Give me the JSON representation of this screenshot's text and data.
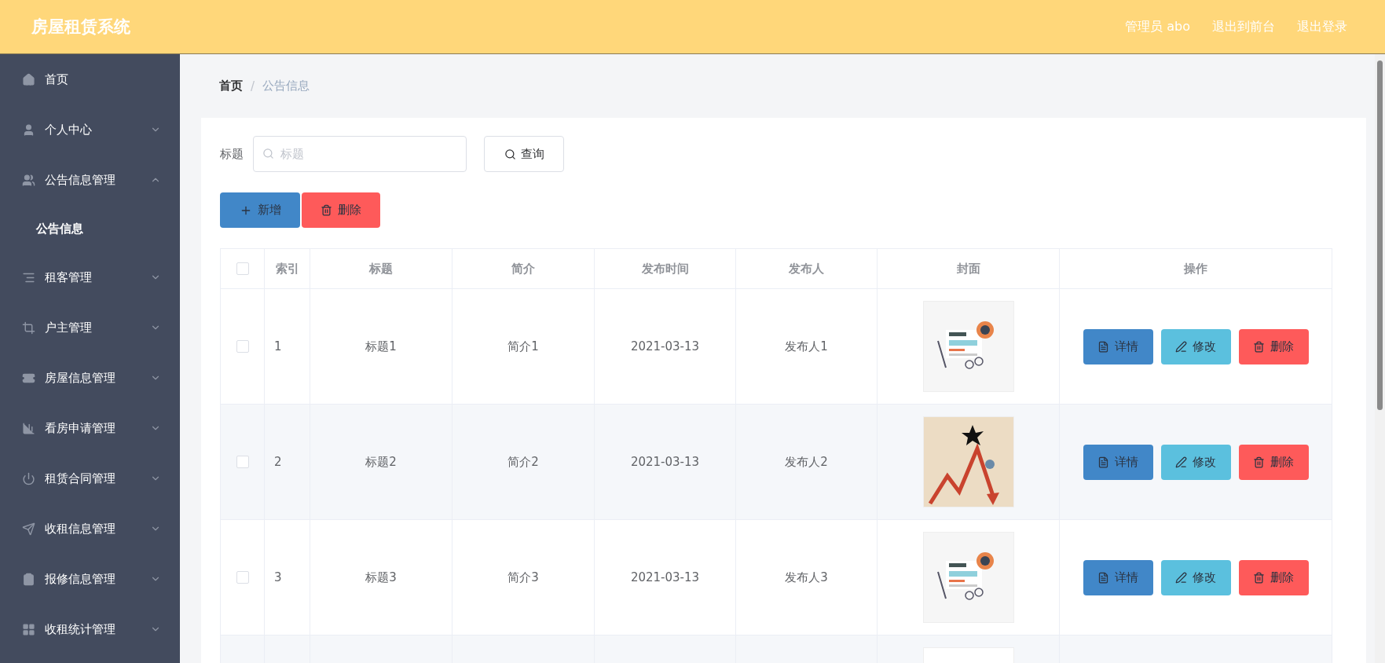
{
  "header": {
    "title": "房屋租赁系统",
    "links": [
      "管理员 abo",
      "退出到前台",
      "退出登录"
    ]
  },
  "sidebar": {
    "items": [
      {
        "label": "首页",
        "kind": "link"
      },
      {
        "label": "个人中心",
        "kind": "submenu",
        "expanded": false
      },
      {
        "label": "公告信息管理",
        "kind": "submenu",
        "expanded": true,
        "children": [
          {
            "label": "公告信息",
            "selected": true
          }
        ]
      },
      {
        "label": "租客管理",
        "kind": "submenu",
        "expanded": false
      },
      {
        "label": "户主管理",
        "kind": "submenu",
        "expanded": false
      },
      {
        "label": "房屋信息管理",
        "kind": "submenu",
        "expanded": false
      },
      {
        "label": "看房申请管理",
        "kind": "submenu",
        "expanded": false
      },
      {
        "label": "租赁合同管理",
        "kind": "submenu",
        "expanded": false
      },
      {
        "label": "收租信息管理",
        "kind": "submenu",
        "expanded": false
      },
      {
        "label": "报修信息管理",
        "kind": "submenu",
        "expanded": false
      },
      {
        "label": "收租统计管理",
        "kind": "submenu",
        "expanded": false
      }
    ]
  },
  "breadcrumb": {
    "items": [
      "首页",
      "公告信息"
    ],
    "separator": "/"
  },
  "search": {
    "label": "标题",
    "placeholder": "标题",
    "button": "查询"
  },
  "actions": {
    "add": "新增",
    "delete": "删除"
  },
  "table": {
    "header_checked": false,
    "columns": [
      "索引",
      "标题",
      "简介",
      "发布时间",
      "发布人",
      "封面",
      "操作"
    ],
    "rows": [
      {
        "checked": false,
        "index": "1",
        "title": "标题1",
        "summary": "简介1",
        "date": "2021-03-13",
        "publisher": "发布人1",
        "buttons": [
          "详情",
          "修改",
          "删除"
        ]
      },
      {
        "checked": false,
        "index": "2",
        "title": "标题2",
        "summary": "简介2",
        "date": "2021-03-13",
        "publisher": "发布人2",
        "buttons": [
          "详情",
          "修改",
          "删除"
        ]
      },
      {
        "checked": false,
        "index": "3",
        "title": "标题3",
        "summary": "简介3",
        "date": "2021-03-13",
        "publisher": "发布人3",
        "buttons": [
          "详情",
          "修改",
          "删除"
        ]
      }
    ]
  }
}
